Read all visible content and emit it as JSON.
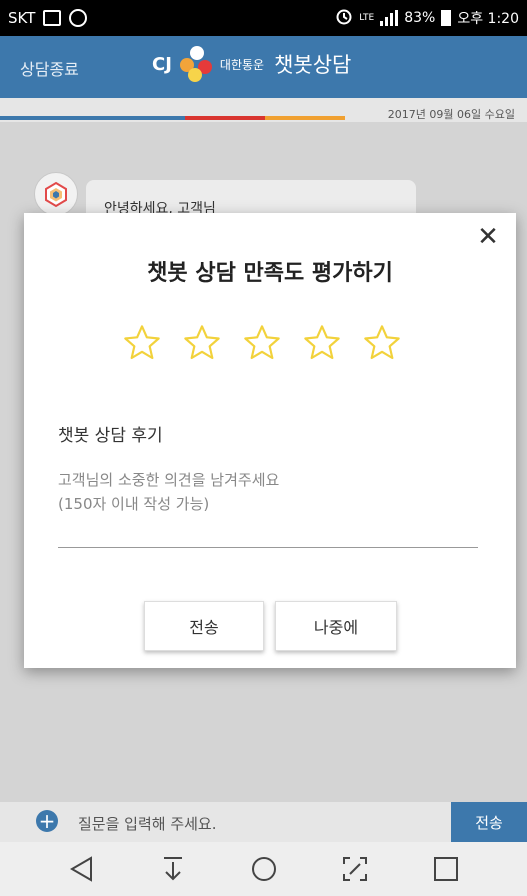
{
  "status_bar": {
    "carrier": "SKT",
    "battery": "83%",
    "time": "오후 1:20"
  },
  "header": {
    "end_chat": "상담종료",
    "logo_cj": "CJ",
    "logo_company": "대한통운",
    "title": "챗봇상담"
  },
  "chat": {
    "date": "2017년 09월 06일 수요일",
    "bot_message": "안녕하세요, 고객님"
  },
  "dialog": {
    "title": "챗봇 상담 만족도 평가하기",
    "close_glyph": "✕",
    "rating": 0,
    "max_rating": 5,
    "review_label": "챗봇 상담 후기",
    "review_placeholder": "고객님의 소중한 의견을 남겨주세요\n(150자 이내 작성 가능)",
    "send_label": "전송",
    "later_label": "나중에"
  },
  "input_bar": {
    "plus": "+",
    "placeholder": "질문을 입력해 주세요.",
    "send_label": "전송"
  },
  "colors": {
    "header_blue": "#3d78ac",
    "star_gold": "#f2d23c",
    "stripe_red": "#d9352f",
    "stripe_orange": "#f0a030"
  }
}
